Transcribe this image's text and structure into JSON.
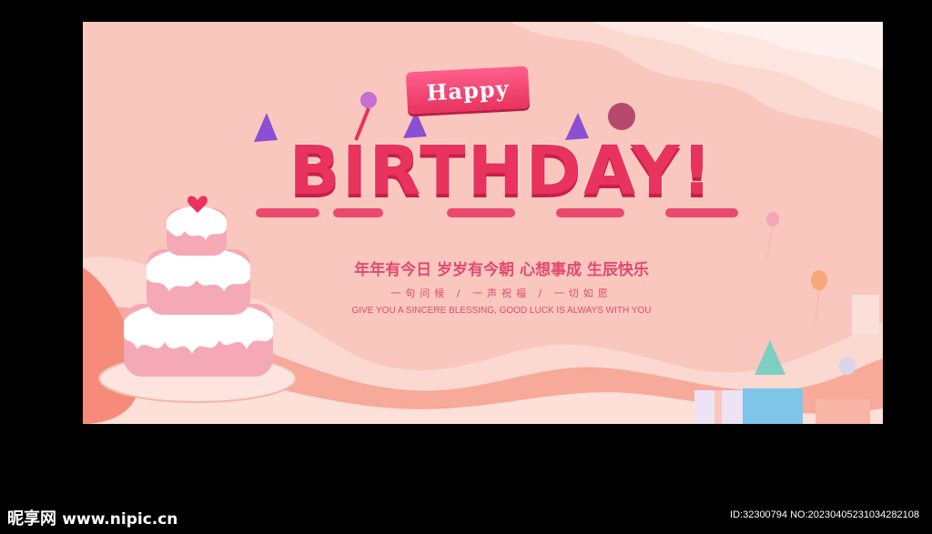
{
  "banner": {
    "happy": "Happy",
    "title": "BIRTHDAY!",
    "blessing": "年年有今日 岁岁有今朝 心想事成 生辰快乐",
    "subtitle": "一句问候 / 一声祝福 / 一切如愿",
    "english": "GIVE YOU A SINCERE BLESSING, GOOD LUCK IS ALWAYS WITH YOU"
  },
  "watermark": {
    "site_name": "昵享网",
    "url": "www.nipic.cn",
    "image_id": "ID:32300794 NO:20230405231034282108"
  },
  "colors": {
    "background": "#f9c7bd",
    "accent": "#e8335f",
    "text": "#e24a70"
  },
  "icons": [
    "cake-icon",
    "party-hat-icon",
    "balloon-icon",
    "gift-box-icon",
    "heart-icon",
    "lollipop-icon"
  ]
}
